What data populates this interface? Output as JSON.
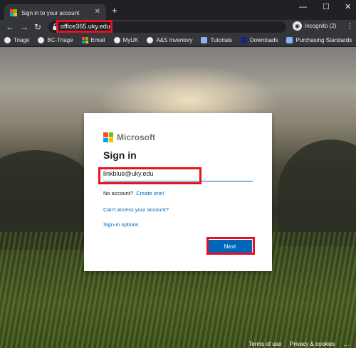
{
  "browser": {
    "tab_title": "Sign in to your account",
    "tab_close": "✕",
    "new_tab": "+",
    "window_controls": {
      "minimize": "—",
      "maximize": "☐",
      "close": "✕"
    },
    "nav": {
      "back": "←",
      "forward": "→",
      "reload": "↻"
    },
    "url": "office365.uky.edu",
    "profile_label": "Incognito (2)",
    "menu": "⋮"
  },
  "bookmarks": [
    {
      "label": "Triage",
      "icon": "circle-icon"
    },
    {
      "label": "BC-Triage",
      "icon": "circle-icon"
    },
    {
      "label": "Email",
      "icon": "mail-icon"
    },
    {
      "label": "MyUK",
      "icon": "circle-icon"
    },
    {
      "label": "A&S Inventory",
      "icon": "circle-icon"
    },
    {
      "label": "Tutorials",
      "icon": "doc-icon"
    },
    {
      "label": "Downloads",
      "icon": "windows-icon"
    },
    {
      "label": "Purchasing Standards",
      "icon": "doc-icon"
    }
  ],
  "card": {
    "brand": "Microsoft",
    "heading": "Sign in",
    "email_value": "linkblue@uky.edu",
    "no_account_text": "No account?",
    "create_link": "Create one!",
    "cant_access": "Can't access your account?",
    "signin_options": "Sign-in options",
    "next_label": "Next"
  },
  "footer": {
    "terms": "Terms of use",
    "privacy": "Privacy & cookies",
    "more": "..."
  },
  "colors": {
    "highlight": "#e81123",
    "accent": "#0067b8",
    "ms_red": "#f25022",
    "ms_green": "#7fba00",
    "ms_blue": "#00a4ef",
    "ms_yellow": "#ffb900"
  }
}
